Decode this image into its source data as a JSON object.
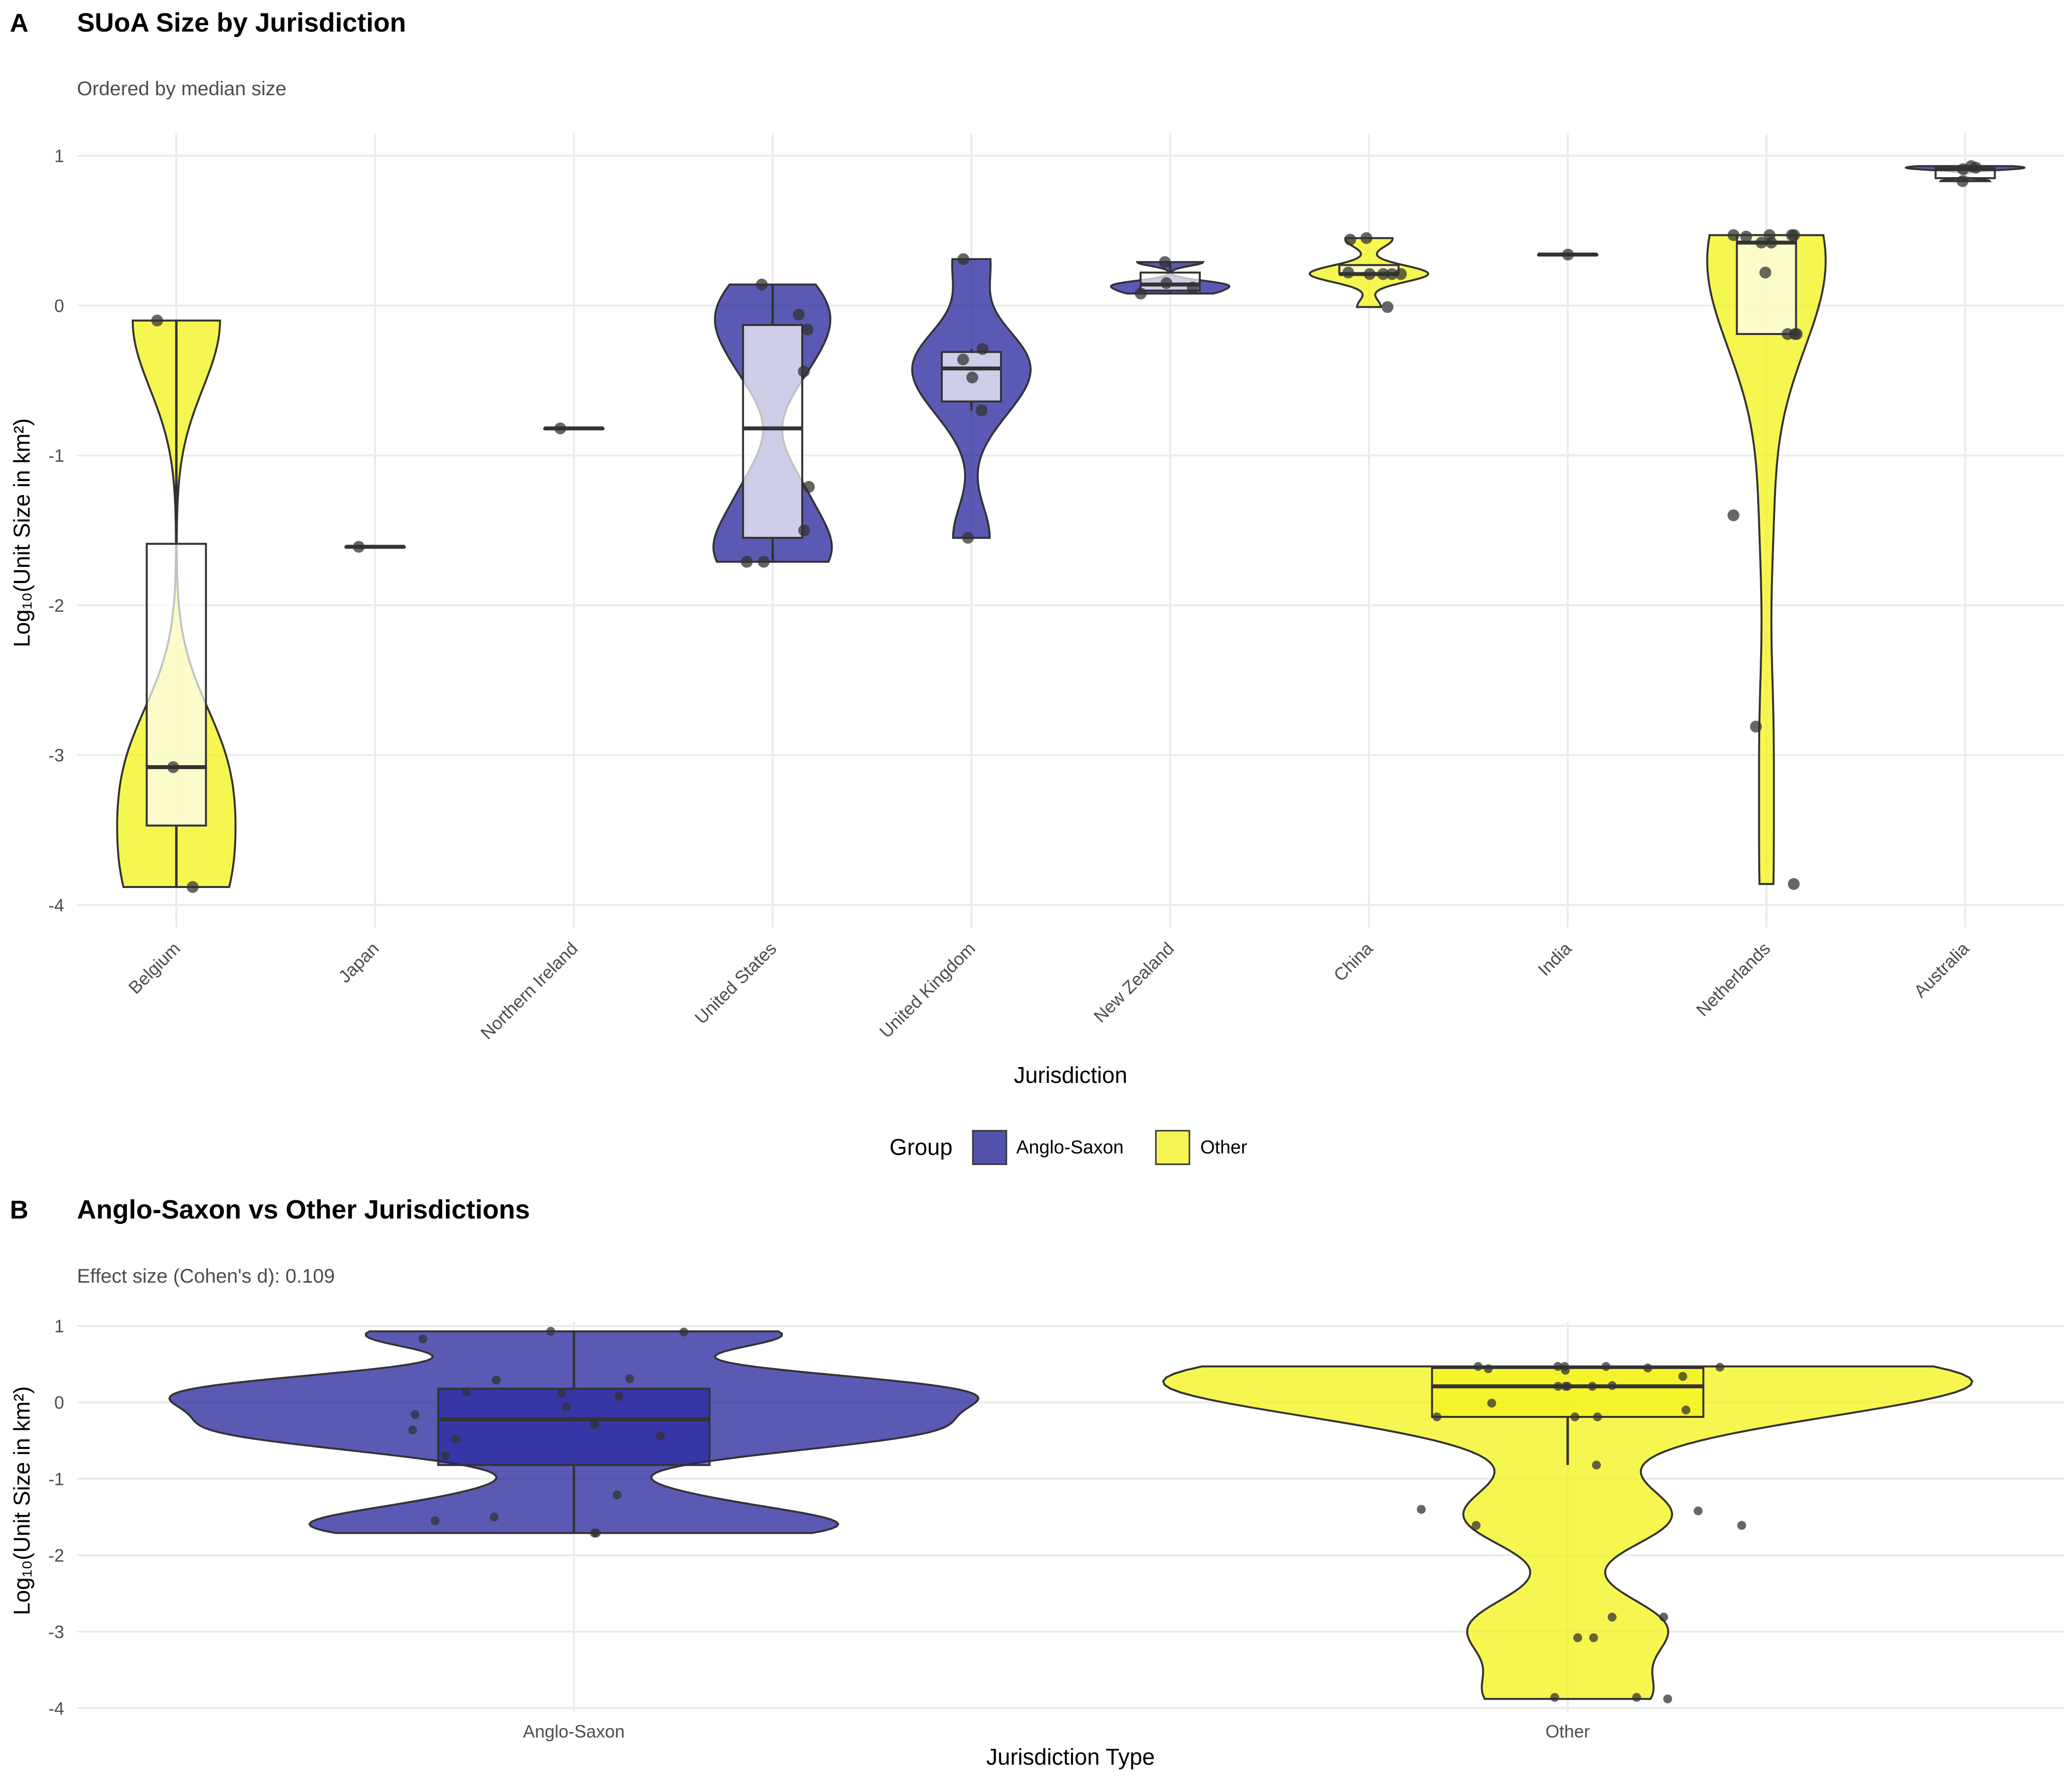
{
  "colors": {
    "anglo_saxon": "#1a1a99",
    "other": "#f2f20d",
    "box_stroke": "#333333",
    "point": "#333333",
    "grid": "#ebebeb"
  },
  "legend": {
    "title": "Group",
    "items": [
      "Anglo-Saxon",
      "Other"
    ]
  },
  "chart_data": [
    {
      "panel": "A",
      "type": "violin",
      "title": "SUoA Size by Jurisdiction",
      "subtitle": "Ordered by median size",
      "xlabel": "Jurisdiction",
      "ylabel": "Log₁₀(Unit Size in km²)",
      "ylim": [
        -4.15,
        1.15
      ],
      "yticks": [
        1,
        0,
        -1,
        -2,
        -3,
        -4
      ],
      "grid": true,
      "legend_position": "bottom",
      "categories": [
        "Belgium",
        "Japan",
        "Northern Ireland",
        "United States",
        "United Kingdom",
        "New Zealand",
        "China",
        "India",
        "Netherlands",
        "Australia"
      ],
      "groups": [
        "Other",
        "Other",
        "Anglo-Saxon",
        "Anglo-Saxon",
        "Anglo-Saxon",
        "Anglo-Saxon",
        "Other",
        "Other",
        "Other",
        "Anglo-Saxon"
      ],
      "series": [
        {
          "name": "Belgium",
          "group": "Other",
          "points": [
            -0.1,
            -3.08,
            -3.88
          ],
          "box": {
            "q1": -3.47,
            "median": -3.08,
            "q3": -1.59,
            "lower": -3.88,
            "upper": -0.1
          }
        },
        {
          "name": "Japan",
          "group": "Other",
          "points": [
            -1.61
          ],
          "box": {
            "q1": -1.61,
            "median": -1.61,
            "q3": -1.61,
            "lower": -1.61,
            "upper": -1.61
          }
        },
        {
          "name": "Northern Ireland",
          "group": "Anglo-Saxon",
          "points": [
            -0.82
          ],
          "box": {
            "q1": -0.82,
            "median": -0.82,
            "q3": -0.82,
            "lower": -0.82,
            "upper": -0.82
          }
        },
        {
          "name": "United States",
          "group": "Anglo-Saxon",
          "points": [
            0.14,
            -0.06,
            -0.16,
            -0.44,
            -1.21,
            -1.5,
            -1.71,
            -1.71
          ],
          "box": {
            "q1": -1.55,
            "median": -0.82,
            "q3": -0.13,
            "lower": -1.71,
            "upper": 0.14
          }
        },
        {
          "name": "United Kingdom",
          "group": "Anglo-Saxon",
          "points": [
            0.31,
            -0.29,
            -0.36,
            -0.48,
            -0.7,
            -1.55
          ],
          "box": {
            "q1": -0.64,
            "median": -0.42,
            "q3": -0.31,
            "lower": -0.7,
            "upper": -0.29
          }
        },
        {
          "name": "New Zealand",
          "group": "Anglo-Saxon",
          "points": [
            0.29,
            0.15,
            0.12,
            0.08
          ],
          "box": {
            "q1": 0.1,
            "median": 0.14,
            "q3": 0.22,
            "lower": 0.08,
            "upper": 0.29
          }
        },
        {
          "name": "China",
          "group": "Other",
          "points": [
            0.45,
            0.44,
            0.22,
            0.21,
            0.21,
            0.21,
            0.21,
            -0.01
          ],
          "box": {
            "q1": 0.21,
            "median": 0.21,
            "q3": 0.27,
            "lower": 0.21,
            "upper": 0.27
          }
        },
        {
          "name": "India",
          "group": "Other",
          "points": [
            0.34
          ],
          "box": {
            "q1": 0.34,
            "median": 0.34,
            "q3": 0.34,
            "lower": 0.34,
            "upper": 0.34
          }
        },
        {
          "name": "Netherlands",
          "group": "Other",
          "points": [
            0.47,
            0.47,
            0.47,
            0.47,
            0.46,
            0.42,
            0.42,
            0.22,
            -0.19,
            -0.19,
            -0.19,
            -1.4,
            -2.81,
            -3.86
          ],
          "box": {
            "q1": -0.19,
            "median": 0.42,
            "q3": 0.47,
            "lower": -0.19,
            "upper": 0.47
          }
        },
        {
          "name": "Australia",
          "group": "Anglo-Saxon",
          "points": [
            0.93,
            0.92,
            0.91,
            0.83
          ],
          "box": {
            "q1": 0.85,
            "median": 0.91,
            "q3": 0.93,
            "lower": 0.83,
            "upper": 0.93
          }
        }
      ]
    },
    {
      "panel": "B",
      "type": "violin",
      "title": "Anglo-Saxon vs Other Jurisdictions",
      "subtitle": "Effect size (Cohen's d): 0.109",
      "xlabel": "Jurisdiction Type",
      "ylabel": "Log₁₀(Unit Size in km²)",
      "ylim": [
        -4.05,
        1.05
      ],
      "yticks": [
        1,
        0,
        -1,
        -2,
        -3,
        -4
      ],
      "grid": true,
      "categories": [
        "Anglo-Saxon",
        "Other"
      ],
      "series": [
        {
          "name": "Anglo-Saxon",
          "points": [
            0.93,
            0.92,
            0.83,
            0.31,
            0.29,
            0.14,
            0.12,
            0.08,
            -0.06,
            -0.16,
            -0.29,
            -0.36,
            -0.44,
            -0.48,
            -0.7,
            -1.21,
            -1.5,
            -1.55,
            -1.71,
            -1.71
          ],
          "box": {
            "q1": -0.82,
            "median": -0.22,
            "q3": 0.18,
            "lower": -1.71,
            "upper": 0.93
          }
        },
        {
          "name": "Other",
          "points": [
            0.47,
            0.47,
            0.47,
            0.47,
            0.46,
            0.45,
            0.44,
            0.42,
            0.34,
            0.22,
            0.21,
            0.21,
            0.21,
            0.21,
            -0.01,
            -0.1,
            -0.19,
            -0.19,
            -0.19,
            -0.82,
            -1.4,
            -1.42,
            -1.61,
            -1.61,
            -2.81,
            -2.81,
            -3.08,
            -3.08,
            -3.86,
            -3.86,
            -3.88
          ],
          "box": {
            "q1": -0.19,
            "median": 0.21,
            "q3": 0.45,
            "lower": -0.82,
            "upper": 0.47
          }
        }
      ]
    }
  ]
}
